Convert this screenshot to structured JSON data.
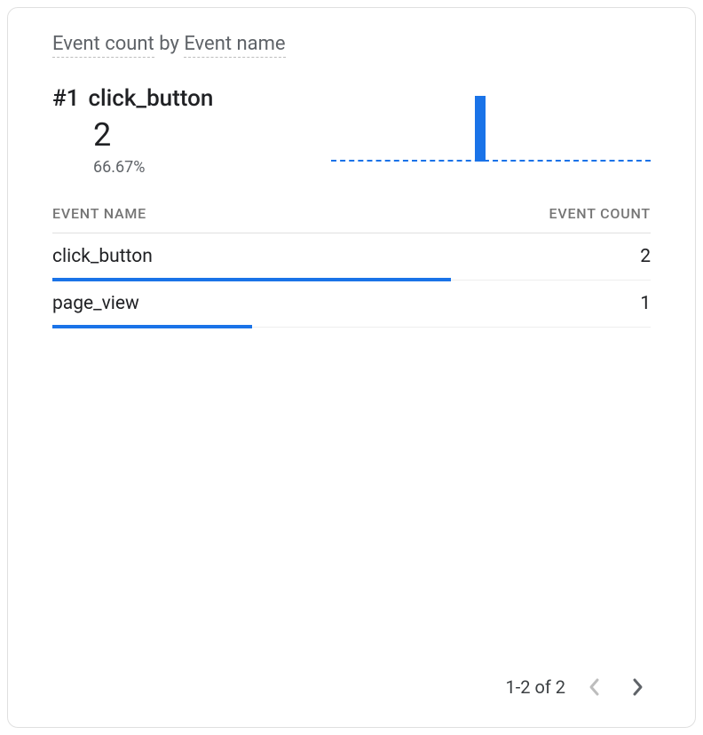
{
  "title": {
    "metric": "Event count",
    "by": " by ",
    "dimension": "Event name"
  },
  "top_item": {
    "rank": "#1",
    "name": "click_button",
    "value": "2",
    "percent": "66.67%"
  },
  "columns": {
    "name": "EVENT NAME",
    "count": "EVENT COUNT"
  },
  "rows": [
    {
      "name": "click_button",
      "value": "2",
      "bar_pct": 66.67
    },
    {
      "name": "page_view",
      "value": "1",
      "bar_pct": 33.33
    }
  ],
  "pagination": {
    "range": "1-2 of 2"
  },
  "colors": {
    "accent": "#1a73e8"
  },
  "chart_data": {
    "type": "bar",
    "title": "Event count by Event name",
    "categories": [
      "click_button",
      "page_view"
    ],
    "values": [
      2,
      1
    ],
    "xlabel": "Event name",
    "ylabel": "Event count",
    "ylim": [
      0,
      2
    ]
  }
}
